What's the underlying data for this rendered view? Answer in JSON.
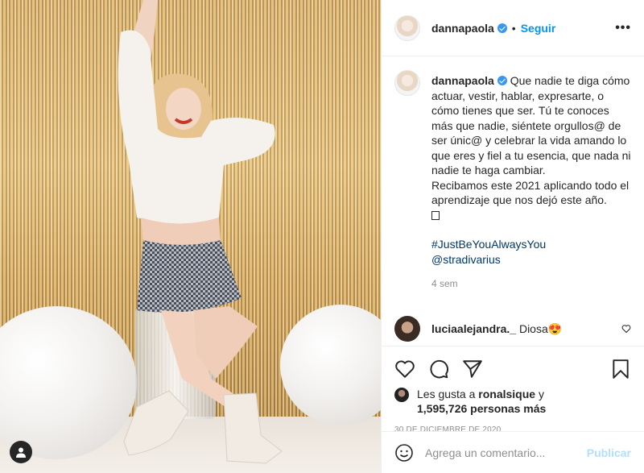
{
  "header": {
    "username": "dannapaola",
    "separator": "•",
    "follow_label": "Seguir",
    "more_label": "•••"
  },
  "caption": {
    "username": "dannapaola",
    "text_lines": [
      "Que nadie te diga cómo actuar, vestir, hablar, expresarte, o cómo tienes que ser.",
      "Tú te conoces más que nadie, siéntete orgullos@ de ser únic@ y celebrar la vida amando lo que eres y fiel a tu esencia, que nada ni nadie te haga cambiar.",
      "Recibamos este 2021 aplicando todo el aprendizaje que nos dejó este año."
    ],
    "hashtag": "#JustBeYouAlwaysYou",
    "mention": "@stradivarius",
    "time": "4 sem"
  },
  "comment": {
    "username": "luciaalejandra._",
    "text": "Diosa😍"
  },
  "likes": {
    "prefix": "Les gusta a",
    "user": "ronalsique",
    "connector": "y",
    "count_text": "1,595,726 personas más"
  },
  "date": "30 DE DICIEMBRE DE 2020",
  "add_comment": {
    "placeholder": "Agrega un comentario...",
    "publish_label": "Publicar"
  },
  "icons": {
    "like": "heart-icon",
    "comment": "comment-bubble-icon",
    "share": "paper-plane-icon",
    "save": "bookmark-icon",
    "emoji": "smiley-icon",
    "user_tag": "user-icon"
  },
  "colors": {
    "link_blue": "#0095f6",
    "hashtag": "#00376b",
    "muted": "#8e8e8e",
    "publish_disabled": "#b2dffc",
    "verified": "#3897f0"
  }
}
